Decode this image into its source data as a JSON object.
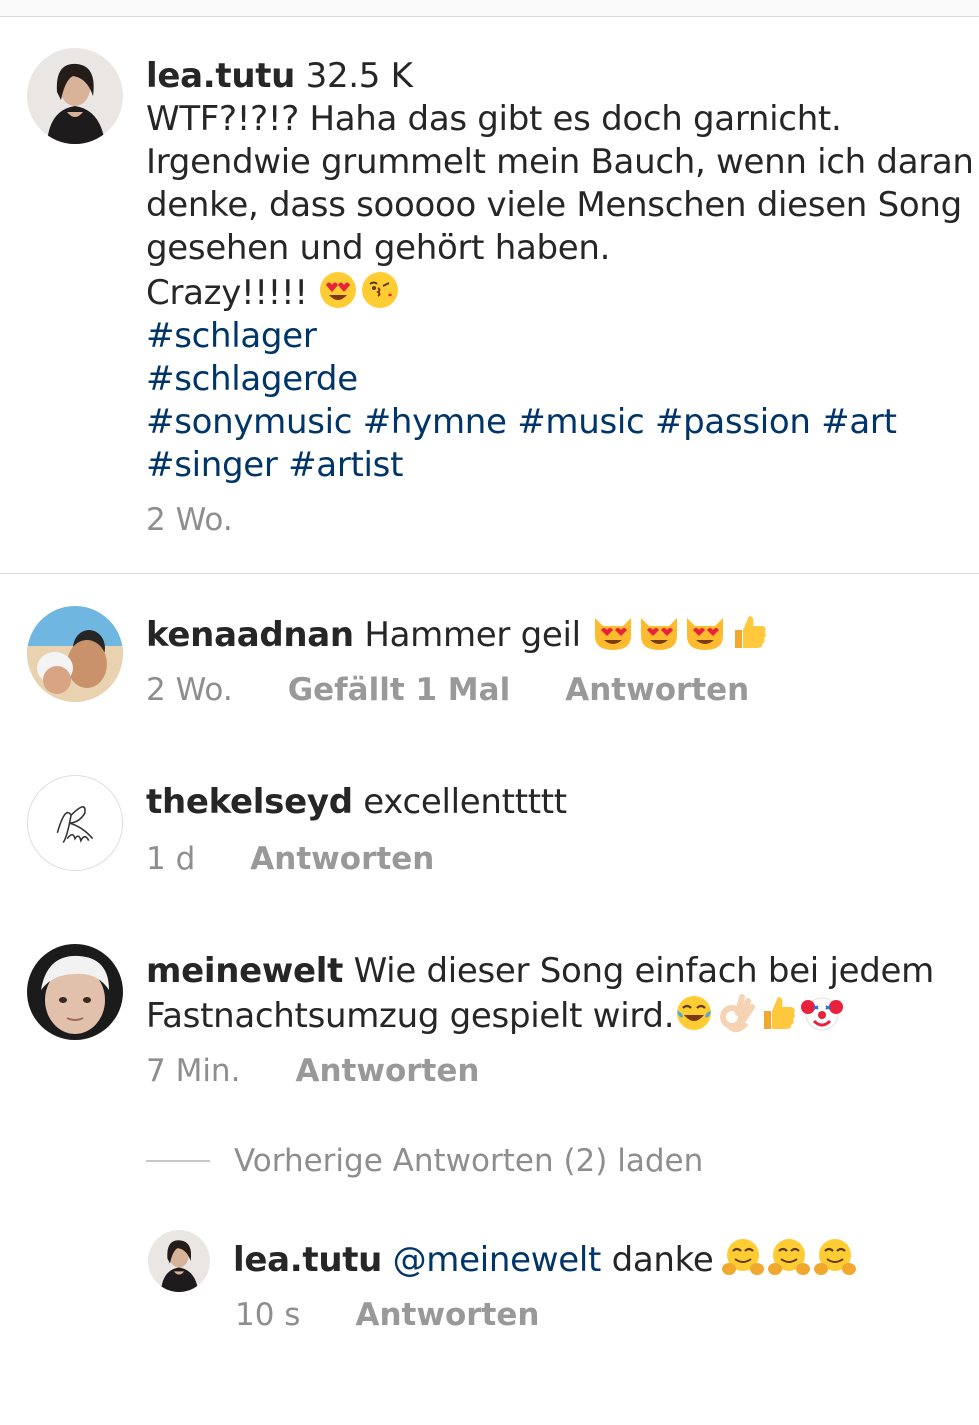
{
  "post": {
    "username": "lea.tutu",
    "follower_count": "32.5 K",
    "line1": "WTF?!?!? Haha das gibt es doch garnicht.",
    "line2": "Irgendwie grummelt mein Bauch, wenn ich daran",
    "line3": "denke, dass sooooo viele Menschen diesen Song",
    "line4": "gesehen und gehört haben.",
    "line5": "Crazy!!!!!",
    "line5_emojis": [
      "heart-eyes-emoji",
      "kiss-emoji"
    ],
    "hashtags_line1": "#schlager",
    "hashtags_line2": "#schlagerde",
    "hashtags_line3": [
      "#sonymusic",
      "#hymne",
      "#music",
      "#passion",
      "#art"
    ],
    "hashtags_line4": [
      "#singer",
      "#artist"
    ],
    "time": "2 Wo."
  },
  "comments": [
    {
      "username": "kenaadnan",
      "text": "Hammer geil",
      "emojis": [
        "heart-eyes-cat-emoji",
        "heart-eyes-cat-emoji",
        "heart-eyes-cat-emoji",
        "thumbs-up-emoji"
      ],
      "time": "2 Wo.",
      "likes": "Gefällt 1 Mal",
      "reply": "Antworten"
    },
    {
      "username": "thekelseyd",
      "text": "excellenttttt",
      "time": "1 d",
      "reply": "Antworten"
    },
    {
      "username": "meinewelt",
      "text_line1": "Wie dieser Song einfach bei jedem",
      "text_line2": "Fastnachtsumzug gespielt wird.",
      "emojis": [
        "tears-of-joy-emoji",
        "ok-hand-emoji",
        "thumbs-up-emoji",
        "clown-emoji"
      ],
      "time": "7 Min.",
      "reply": "Antworten"
    }
  ],
  "load_previous": "Vorherige Antworten (2) laden",
  "reply_comment": {
    "username": "lea.tutu",
    "mention": "@meinewelt",
    "text": "danke",
    "emojis": [
      "hugging-emoji",
      "hugging-emoji",
      "hugging-emoji"
    ],
    "time": "10 s",
    "reply": "Antworten"
  },
  "colors": {
    "hashtag": "#003569",
    "meta": "#8e8e8e",
    "text": "#262626"
  }
}
